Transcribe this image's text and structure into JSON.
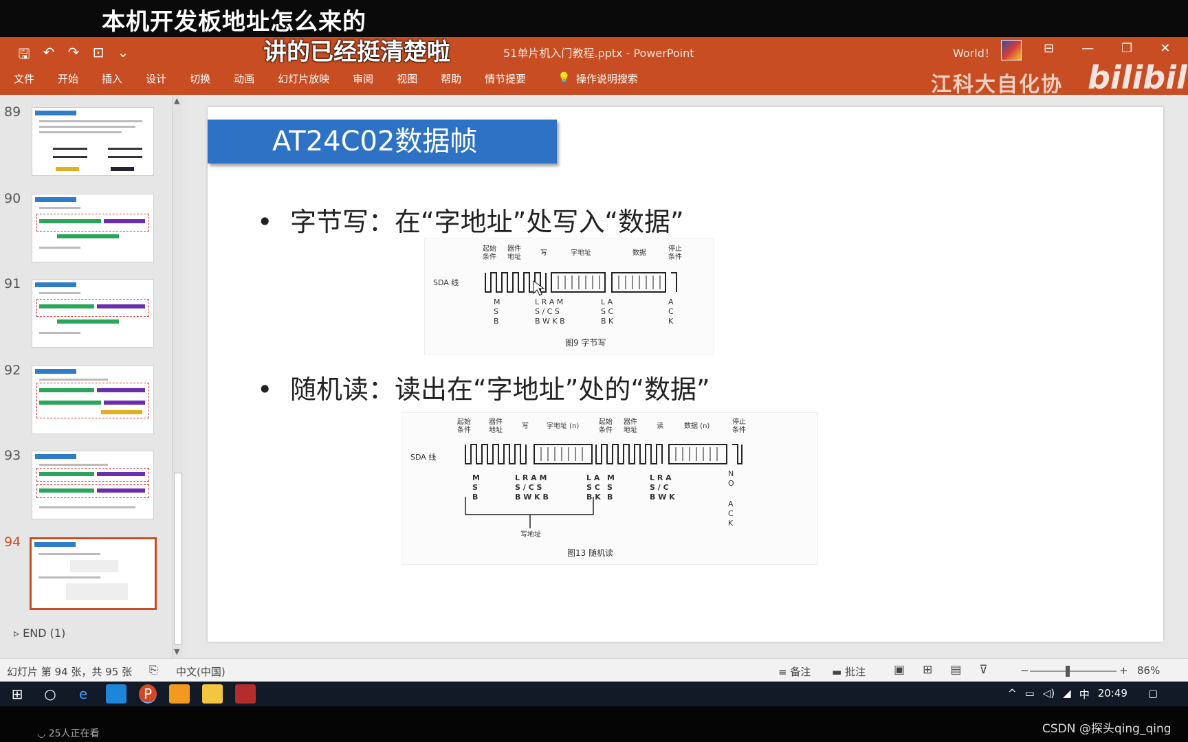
{
  "subtitles": {
    "line1": "本机开发板地址怎么来的",
    "line2": "讲的已经挺清楚啦"
  },
  "titlebar": {
    "document_title": "51单片机入门教程.pptx  -  PowerPoint",
    "user_label": "World！",
    "quick_access": [
      "save-icon",
      "undo-icon",
      "redo-icon",
      "present-icon",
      "customize-icon"
    ],
    "window_buttons": [
      "ribbon-display-icon",
      "minimize-icon",
      "restore-icon",
      "close-icon"
    ]
  },
  "ribbon": {
    "tabs": [
      "文件",
      "开始",
      "插入",
      "设计",
      "切换",
      "动画",
      "幻灯片放映",
      "审阅",
      "视图",
      "帮助",
      "情节提要"
    ],
    "search_label": "操作说明搜索",
    "watermark": "江科大自化协",
    "watermark_logo": "bilibili"
  },
  "thumbnails": {
    "items": [
      {
        "number": "89"
      },
      {
        "number": "90"
      },
      {
        "number": "91"
      },
      {
        "number": "92"
      },
      {
        "number": "93"
      },
      {
        "number": "94",
        "active": true
      }
    ],
    "section": "END (1)"
  },
  "slide": {
    "title": "AT24C02数据帧",
    "bullet1": "字节写：在“字地址”处写入“数据”",
    "bullet2": "随机读：读出在“字地址”处的“数据”",
    "figure1": {
      "sda_label": "SDA 线",
      "headers": [
        "起始\n条件",
        "器件\n地址",
        "写",
        "字地址",
        "数据",
        "停止\n条件"
      ],
      "below": [
        "M S B",
        "L R A M",
        "S / C S",
        "B W K B",
        "L A",
        "S C",
        "B K",
        "A C K"
      ],
      "caption": "图9 字节写"
    },
    "figure2": {
      "sda_label": "SDA 线",
      "headers": [
        "起始\n条件",
        "器件\n地址",
        "写",
        "字地址 (n)",
        "起始\n条件",
        "器件\n地址",
        "读",
        "数据 (n)",
        "停止\n条件"
      ],
      "write_addr": "写地址",
      "caption": "图13 随机读"
    }
  },
  "statusbar": {
    "slide_info": "幻灯片 第 94 张，共 95 张",
    "language": "中文(中国)",
    "notes": "备注",
    "comments": "批注",
    "zoom": "86%"
  },
  "taskbar": {
    "time": "20:49",
    "ime": "中"
  },
  "overlay": {
    "viewers": "25人正在看",
    "credit": "CSDN @探头qing_qing"
  }
}
